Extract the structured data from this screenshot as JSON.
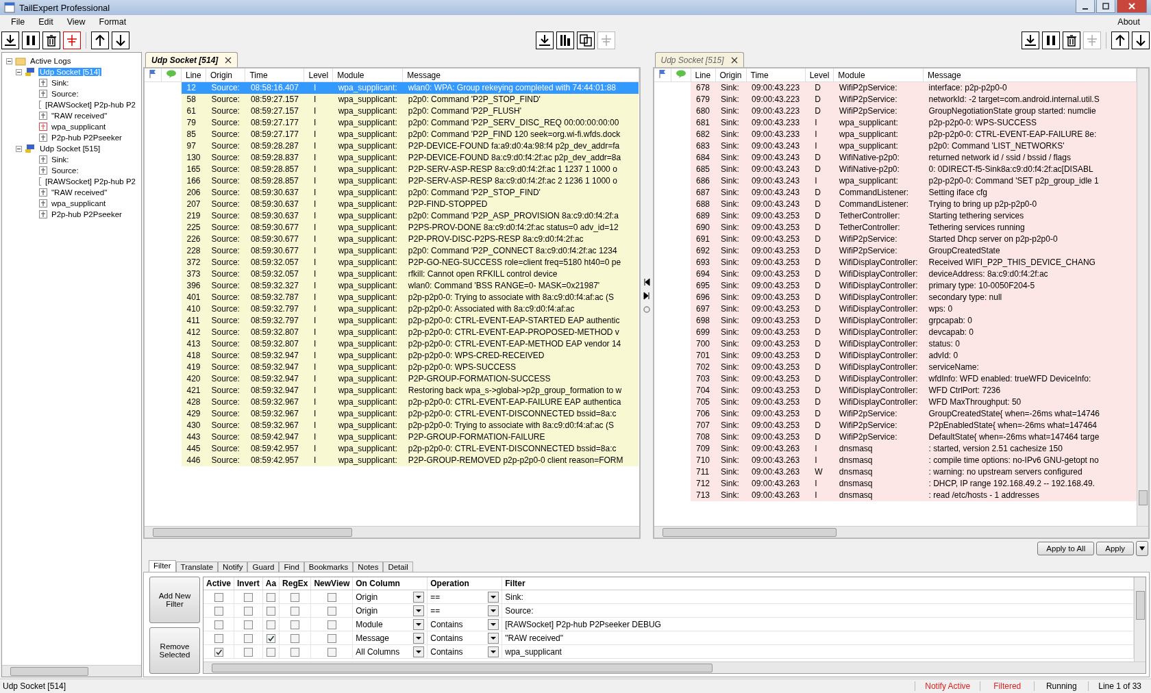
{
  "window": {
    "title": "TailExpert Professional"
  },
  "menu": [
    "File",
    "Edit",
    "View",
    "Format"
  ],
  "menu_right": "About",
  "toolbar_left": [
    {
      "kind": "tail",
      "on": false,
      "disabled": false
    },
    {
      "kind": "pause",
      "on": false,
      "disabled": false
    },
    {
      "kind": "clear",
      "on": false,
      "disabled": false
    },
    {
      "kind": "filter",
      "on": true,
      "disabled": false
    },
    {
      "kind": "up",
      "on": false,
      "disabled": false
    },
    {
      "kind": "down",
      "on": false,
      "disabled": false
    }
  ],
  "toolbar_center": [
    {
      "kind": "tail",
      "disabled": false
    },
    {
      "kind": "columns",
      "disabled": false
    },
    {
      "kind": "copy",
      "disabled": false
    },
    {
      "kind": "filter",
      "disabled": true
    }
  ],
  "toolbar_right": [
    {
      "kind": "tail",
      "disabled": false
    },
    {
      "kind": "pause",
      "disabled": false
    },
    {
      "kind": "clear",
      "disabled": false
    },
    {
      "kind": "filter",
      "disabled": true
    },
    {
      "kind": "up",
      "disabled": false
    },
    {
      "kind": "down",
      "disabled": false
    }
  ],
  "tree": {
    "label": "Active Logs",
    "expanded": true,
    "children": [
      {
        "label": "Udp Socket [514]",
        "selected": true,
        "expanded": true,
        "children": [
          {
            "label": "Sink:",
            "active": false
          },
          {
            "label": "Source:",
            "active": false
          },
          {
            "label": "[RAWSocket] P2p-hub P2",
            "active": false
          },
          {
            "label": "\"RAW received\"",
            "active": false
          },
          {
            "label": "wpa_supplicant",
            "active": true
          },
          {
            "label": "P2p-hub P2Pseeker",
            "active": false
          }
        ]
      },
      {
        "label": "Udp Socket [515]",
        "selected": false,
        "expanded": true,
        "children": [
          {
            "label": "Sink:",
            "active": false
          },
          {
            "label": "Source:",
            "active": false
          },
          {
            "label": "[RAWSocket] P2p-hub P2",
            "active": false
          },
          {
            "label": "\"RAW received\"",
            "active": false
          },
          {
            "label": "wpa_supplicant",
            "active": false
          },
          {
            "label": "P2p-hub P2Pseeker",
            "active": false
          }
        ]
      }
    ]
  },
  "panes": [
    {
      "tab": "Udp Socket [514]",
      "selected": true,
      "color": "#f8f8d2",
      "columns": [
        "Line",
        "Origin",
        "Time",
        "Level",
        "Module",
        "Message"
      ],
      "rows": [
        {
          "line": "12",
          "origin": "Source:",
          "time": "08:58:16.407",
          "level": "I",
          "module": "wpa_supplicant:",
          "message": "wlan0: WPA: Group rekeying completed with 74:44:01:88",
          "selected": true
        },
        {
          "line": "58",
          "origin": "Source:",
          "time": "08:59:27.157",
          "level": "I",
          "module": "wpa_supplicant:",
          "message": "p2p0: Command 'P2P_STOP_FIND'",
          "selected": false
        },
        {
          "line": "61",
          "origin": "Source:",
          "time": "08:59:27.157",
          "level": "I",
          "module": "wpa_supplicant:",
          "message": "p2p0: Command 'P2P_FLUSH'",
          "selected": false
        },
        {
          "line": "79",
          "origin": "Source:",
          "time": "08:59:27.177",
          "level": "I",
          "module": "wpa_supplicant:",
          "message": "p2p0: Command 'P2P_SERV_DISC_REQ 00:00:00:00:00",
          "selected": false
        },
        {
          "line": "85",
          "origin": "Source:",
          "time": "08:59:27.177",
          "level": "I",
          "module": "wpa_supplicant:",
          "message": "p2p0: Command 'P2P_FIND 120 seek=org.wi-fi.wfds.dock",
          "selected": false
        },
        {
          "line": "97",
          "origin": "Source:",
          "time": "08:59:28.287",
          "level": "I",
          "module": "wpa_supplicant:",
          "message": "P2P-DEVICE-FOUND fa:a9:d0:4a:98:f4 p2p_dev_addr=fa",
          "selected": false
        },
        {
          "line": "130",
          "origin": "Source:",
          "time": "08:59:28.837",
          "level": "I",
          "module": "wpa_supplicant:",
          "message": "P2P-DEVICE-FOUND 8a:c9:d0:f4:2f:ac p2p_dev_addr=8a",
          "selected": false
        },
        {
          "line": "165",
          "origin": "Source:",
          "time": "08:59:28.857",
          "level": "I",
          "module": "wpa_supplicant:",
          "message": "P2P-SERV-ASP-RESP 8a:c9:d0:f4:2f:ac 1 1237 1 1000 o",
          "selected": false
        },
        {
          "line": "166",
          "origin": "Source:",
          "time": "08:59:28.857",
          "level": "I",
          "module": "wpa_supplicant:",
          "message": "P2P-SERV-ASP-RESP 8a:c9:d0:f4:2f:ac 2 1236 1 1000 o",
          "selected": false
        },
        {
          "line": "206",
          "origin": "Source:",
          "time": "08:59:30.637",
          "level": "I",
          "module": "wpa_supplicant:",
          "message": "p2p0: Command 'P2P_STOP_FIND'",
          "selected": false
        },
        {
          "line": "207",
          "origin": "Source:",
          "time": "08:59:30.637",
          "level": "I",
          "module": "wpa_supplicant:",
          "message": "P2P-FIND-STOPPED",
          "selected": false
        },
        {
          "line": "219",
          "origin": "Source:",
          "time": "08:59:30.637",
          "level": "I",
          "module": "wpa_supplicant:",
          "message": "p2p0: Command 'P2P_ASP_PROVISION 8a:c9:d0:f4:2f:a",
          "selected": false
        },
        {
          "line": "225",
          "origin": "Source:",
          "time": "08:59:30.677",
          "level": "I",
          "module": "wpa_supplicant:",
          "message": "P2PS-PROV-DONE 8a:c9:d0:f4:2f:ac status=0 adv_id=12",
          "selected": false
        },
        {
          "line": "226",
          "origin": "Source:",
          "time": "08:59:30.677",
          "level": "I",
          "module": "wpa_supplicant:",
          "message": "P2P-PROV-DISC-P2PS-RESP 8a:c9:d0:f4:2f:ac",
          "selected": false
        },
        {
          "line": "228",
          "origin": "Source:",
          "time": "08:59:30.677",
          "level": "I",
          "module": "wpa_supplicant:",
          "message": "p2p0: Command 'P2P_CONNECT 8a:c9:d0:f4:2f:ac 1234",
          "selected": false
        },
        {
          "line": "372",
          "origin": "Source:",
          "time": "08:59:32.057",
          "level": "I",
          "module": "wpa_supplicant:",
          "message": "P2P-GO-NEG-SUCCESS role=client freq=5180 ht40=0 pe",
          "selected": false
        },
        {
          "line": "373",
          "origin": "Source:",
          "time": "08:59:32.057",
          "level": "I",
          "module": "wpa_supplicant:",
          "message": "rfkill: Cannot open RFKILL control device",
          "selected": false
        },
        {
          "line": "396",
          "origin": "Source:",
          "time": "08:59:32.327",
          "level": "I",
          "module": "wpa_supplicant:",
          "message": "wlan0: Command 'BSS RANGE=0- MASK=0x21987'",
          "selected": false
        },
        {
          "line": "401",
          "origin": "Source:",
          "time": "08:59:32.787",
          "level": "I",
          "module": "wpa_supplicant:",
          "message": "p2p-p2p0-0: Trying to associate with 8a:c9:d0:f4:af:ac (S",
          "selected": false
        },
        {
          "line": "410",
          "origin": "Source:",
          "time": "08:59:32.797",
          "level": "I",
          "module": "wpa_supplicant:",
          "message": "p2p-p2p0-0: Associated with 8a:c9:d0:f4:af:ac",
          "selected": false
        },
        {
          "line": "411",
          "origin": "Source:",
          "time": "08:59:32.797",
          "level": "I",
          "module": "wpa_supplicant:",
          "message": "p2p-p2p0-0: CTRL-EVENT-EAP-STARTED EAP authentic",
          "selected": false
        },
        {
          "line": "412",
          "origin": "Source:",
          "time": "08:59:32.807",
          "level": "I",
          "module": "wpa_supplicant:",
          "message": "p2p-p2p0-0: CTRL-EVENT-EAP-PROPOSED-METHOD v",
          "selected": false
        },
        {
          "line": "413",
          "origin": "Source:",
          "time": "08:59:32.807",
          "level": "I",
          "module": "wpa_supplicant:",
          "message": "p2p-p2p0-0: CTRL-EVENT-EAP-METHOD EAP vendor 14",
          "selected": false
        },
        {
          "line": "418",
          "origin": "Source:",
          "time": "08:59:32.947",
          "level": "I",
          "module": "wpa_supplicant:",
          "message": "p2p-p2p0-0: WPS-CRED-RECEIVED",
          "selected": false
        },
        {
          "line": "419",
          "origin": "Source:",
          "time": "08:59:32.947",
          "level": "I",
          "module": "wpa_supplicant:",
          "message": "p2p-p2p0-0: WPS-SUCCESS",
          "selected": false
        },
        {
          "line": "420",
          "origin": "Source:",
          "time": "08:59:32.947",
          "level": "I",
          "module": "wpa_supplicant:",
          "message": "P2P-GROUP-FORMATION-SUCCESS",
          "selected": false
        },
        {
          "line": "421",
          "origin": "Source:",
          "time": "08:59:32.947",
          "level": "I",
          "module": "wpa_supplicant:",
          "message": "Restoring back wpa_s->global->p2p_group_formation to w",
          "selected": false
        },
        {
          "line": "428",
          "origin": "Source:",
          "time": "08:59:32.967",
          "level": "I",
          "module": "wpa_supplicant:",
          "message": "p2p-p2p0-0: CTRL-EVENT-EAP-FAILURE EAP authentica",
          "selected": false
        },
        {
          "line": "429",
          "origin": "Source:",
          "time": "08:59:32.967",
          "level": "I",
          "module": "wpa_supplicant:",
          "message": "p2p-p2p0-0: CTRL-EVENT-DISCONNECTED bssid=8a:c",
          "selected": false
        },
        {
          "line": "430",
          "origin": "Source:",
          "time": "08:59:32.967",
          "level": "I",
          "module": "wpa_supplicant:",
          "message": "p2p-p2p0-0: Trying to associate with 8a:c9:d0:f4:af:ac (S",
          "selected": false
        },
        {
          "line": "443",
          "origin": "Source:",
          "time": "08:59:42.947",
          "level": "I",
          "module": "wpa_supplicant:",
          "message": "P2P-GROUP-FORMATION-FAILURE",
          "selected": false
        },
        {
          "line": "445",
          "origin": "Source:",
          "time": "08:59:42.957",
          "level": "I",
          "module": "wpa_supplicant:",
          "message": "p2p-p2p0-0: CTRL-EVENT-DISCONNECTED bssid=8a:c",
          "selected": false
        },
        {
          "line": "446",
          "origin": "Source:",
          "time": "08:59:42.957",
          "level": "I",
          "module": "wpa_supplicant:",
          "message": "P2P-GROUP-REMOVED p2p-p2p0-0 client reason=FORM",
          "selected": false
        }
      ]
    },
    {
      "tab": "Udp Socket [515]",
      "selected": false,
      "color": "#fde6e6",
      "columns": [
        "Line",
        "Origin",
        "Time",
        "Level",
        "Module",
        "Message"
      ],
      "rows": [
        {
          "line": "678",
          "origin": "Sink:",
          "time": "09:00:43.223",
          "level": "D",
          "module": "WifiP2pService:",
          "message": "interface: p2p-p2p0-0",
          "selected": false
        },
        {
          "line": "679",
          "origin": "Sink:",
          "time": "09:00:43.223",
          "level": "D",
          "module": "WifiP2pService:",
          "message": "networkId: -2 target=com.android.internal.util.S",
          "selected": false
        },
        {
          "line": "680",
          "origin": "Sink:",
          "time": "09:00:43.223",
          "level": "D",
          "module": "WifiP2pService:",
          "message": "GroupNegotiationState group started: numclie",
          "selected": false
        },
        {
          "line": "681",
          "origin": "Sink:",
          "time": "09:00:43.233",
          "level": "I",
          "module": "wpa_supplicant:",
          "message": "p2p-p2p0-0: WPS-SUCCESS",
          "selected": false
        },
        {
          "line": "682",
          "origin": "Sink:",
          "time": "09:00:43.233",
          "level": "I",
          "module": "wpa_supplicant:",
          "message": "p2p-p2p0-0: CTRL-EVENT-EAP-FAILURE 8e:",
          "selected": false
        },
        {
          "line": "683",
          "origin": "Sink:",
          "time": "09:00:43.243",
          "level": "I",
          "module": "wpa_supplicant:",
          "message": "p2p0: Command 'LIST_NETWORKS'",
          "selected": false
        },
        {
          "line": "684",
          "origin": "Sink:",
          "time": "09:00:43.243",
          "level": "D",
          "module": "WifiNative-p2p0:",
          "message": "returned network id / ssid / bssid / flags",
          "selected": false
        },
        {
          "line": "685",
          "origin": "Sink:",
          "time": "09:00:43.243",
          "level": "D",
          "module": "WifiNative-p2p0:",
          "message": "0: 0DIRECT-f5-Sink8a:c9:d0:f4:2f:ac[DISABL",
          "selected": false
        },
        {
          "line": "686",
          "origin": "Sink:",
          "time": "09:00:43.243",
          "level": "I",
          "module": "wpa_supplicant:",
          "message": "p2p-p2p0-0: Command 'SET p2p_group_idle 1",
          "selected": false
        },
        {
          "line": "687",
          "origin": "Sink:",
          "time": "09:00:43.243",
          "level": "D",
          "module": "CommandListener:",
          "message": "Setting iface cfg",
          "selected": false
        },
        {
          "line": "688",
          "origin": "Sink:",
          "time": "09:00:43.243",
          "level": "D",
          "module": "CommandListener:",
          "message": "Trying to bring up p2p-p2p0-0",
          "selected": false
        },
        {
          "line": "689",
          "origin": "Sink:",
          "time": "09:00:43.253",
          "level": "D",
          "module": "TetherController:",
          "message": "Starting tethering services",
          "selected": false
        },
        {
          "line": "690",
          "origin": "Sink:",
          "time": "09:00:43.253",
          "level": "D",
          "module": "TetherController:",
          "message": "Tethering services running",
          "selected": false
        },
        {
          "line": "691",
          "origin": "Sink:",
          "time": "09:00:43.253",
          "level": "D",
          "module": "WifiP2pService:",
          "message": "Started Dhcp server on p2p-p2p0-0",
          "selected": false
        },
        {
          "line": "692",
          "origin": "Sink:",
          "time": "09:00:43.253",
          "level": "D",
          "module": "WifiP2pService:",
          "message": "GroupCreatedState",
          "selected": false
        },
        {
          "line": "693",
          "origin": "Sink:",
          "time": "09:00:43.253",
          "level": "D",
          "module": "WifiDisplayController:",
          "message": "Received WIFI_P2P_THIS_DEVICE_CHANG",
          "selected": false
        },
        {
          "line": "694",
          "origin": "Sink:",
          "time": "09:00:43.253",
          "level": "D",
          "module": "WifiDisplayController:",
          "message": "deviceAddress: 8a:c9:d0:f4:2f:ac",
          "selected": false
        },
        {
          "line": "695",
          "origin": "Sink:",
          "time": "09:00:43.253",
          "level": "D",
          "module": "WifiDisplayController:",
          "message": "primary type: 10-0050F204-5",
          "selected": false
        },
        {
          "line": "696",
          "origin": "Sink:",
          "time": "09:00:43.253",
          "level": "D",
          "module": "WifiDisplayController:",
          "message": "secondary type: null",
          "selected": false
        },
        {
          "line": "697",
          "origin": "Sink:",
          "time": "09:00:43.253",
          "level": "D",
          "module": "WifiDisplayController:",
          "message": "wps: 0",
          "selected": false
        },
        {
          "line": "698",
          "origin": "Sink:",
          "time": "09:00:43.253",
          "level": "D",
          "module": "WifiDisplayController:",
          "message": "grpcapab: 0",
          "selected": false
        },
        {
          "line": "699",
          "origin": "Sink:",
          "time": "09:00:43.253",
          "level": "D",
          "module": "WifiDisplayController:",
          "message": "devcapab: 0",
          "selected": false
        },
        {
          "line": "700",
          "origin": "Sink:",
          "time": "09:00:43.253",
          "level": "D",
          "module": "WifiDisplayController:",
          "message": "status: 0",
          "selected": false
        },
        {
          "line": "701",
          "origin": "Sink:",
          "time": "09:00:43.253",
          "level": "D",
          "module": "WifiDisplayController:",
          "message": "advId: 0",
          "selected": false
        },
        {
          "line": "702",
          "origin": "Sink:",
          "time": "09:00:43.253",
          "level": "D",
          "module": "WifiDisplayController:",
          "message": "serviceName:",
          "selected": false
        },
        {
          "line": "703",
          "origin": "Sink:",
          "time": "09:00:43.253",
          "level": "D",
          "module": "WifiDisplayController:",
          "message": "wfdInfo: WFD enabled: trueWFD DeviceInfo:",
          "selected": false
        },
        {
          "line": "704",
          "origin": "Sink:",
          "time": "09:00:43.253",
          "level": "D",
          "module": "WifiDisplayController:",
          "message": "WFD CtrlPort: 7236",
          "selected": false
        },
        {
          "line": "705",
          "origin": "Sink:",
          "time": "09:00:43.253",
          "level": "D",
          "module": "WifiDisplayController:",
          "message": "WFD MaxThroughput: 50",
          "selected": false
        },
        {
          "line": "706",
          "origin": "Sink:",
          "time": "09:00:43.253",
          "level": "D",
          "module": "WifiP2pService:",
          "message": "GroupCreatedState{ when=-26ms what=14746",
          "selected": false
        },
        {
          "line": "707",
          "origin": "Sink:",
          "time": "09:00:43.253",
          "level": "D",
          "module": "WifiP2pService:",
          "message": "P2pEnabledState{ when=-26ms what=147464",
          "selected": false
        },
        {
          "line": "708",
          "origin": "Sink:",
          "time": "09:00:43.253",
          "level": "D",
          "module": "WifiP2pService:",
          "message": "DefaultState{ when=-26ms what=147464 targe",
          "selected": false
        },
        {
          "line": "709",
          "origin": "Sink:",
          "time": "09:00:43.263",
          "level": "I",
          "module": "dnsmasq",
          "message": ": started, version 2.51 cachesize 150",
          "selected": false
        },
        {
          "line": "710",
          "origin": "Sink:",
          "time": "09:00:43.263",
          "level": "I",
          "module": "dnsmasq",
          "message": ": compile time options: no-IPv6 GNU-getopt no",
          "selected": false
        },
        {
          "line": "711",
          "origin": "Sink:",
          "time": "09:00:43.263",
          "level": "W",
          "module": "dnsmasq",
          "message": ": warning: no upstream servers configured",
          "selected": false
        },
        {
          "line": "712",
          "origin": "Sink:",
          "time": "09:00:43.263",
          "level": "I",
          "module": "dnsmasq",
          "message": ": DHCP, IP range 192.168.49.2 -- 192.168.49.",
          "selected": false
        },
        {
          "line": "713",
          "origin": "Sink:",
          "time": "09:00:43.263",
          "level": "I",
          "module": "dnsmasq",
          "message": ": read /etc/hosts - 1 addresses",
          "selected": false
        }
      ]
    }
  ],
  "apply_buttons": [
    "Apply to All",
    "Apply"
  ],
  "bottom_tabs": [
    {
      "label": "Filter",
      "selected": true
    },
    {
      "label": "Translate",
      "selected": false
    },
    {
      "label": "Notify",
      "selected": false
    },
    {
      "label": "Guard",
      "selected": false
    },
    {
      "label": "Find",
      "selected": false
    },
    {
      "label": "Bookmarks",
      "selected": false
    },
    {
      "label": "Notes",
      "selected": false
    },
    {
      "label": "Detail",
      "selected": false
    }
  ],
  "filter_buttons": [
    "Add New Filter",
    "Remove Selected"
  ],
  "filter_columns": [
    "Active",
    "Invert",
    "Aa",
    "RegEx",
    "NewView",
    "On Column",
    "Operation",
    "Filter"
  ],
  "filters": [
    {
      "active": false,
      "invert": false,
      "aa": false,
      "regex": false,
      "newview": false,
      "column": "Origin",
      "operation": "==",
      "filter": "Sink:"
    },
    {
      "active": false,
      "invert": false,
      "aa": false,
      "regex": false,
      "newview": false,
      "column": "Origin",
      "operation": "==",
      "filter": "Source:"
    },
    {
      "active": false,
      "invert": false,
      "aa": false,
      "regex": false,
      "newview": false,
      "column": "Module",
      "operation": "Contains",
      "filter": "[RAWSocket] P2p-hub P2Pseeker DEBUG"
    },
    {
      "active": false,
      "invert": false,
      "aa": true,
      "regex": false,
      "newview": false,
      "column": "Message",
      "operation": "Contains",
      "filter": "\"RAW received\""
    },
    {
      "active": true,
      "invert": false,
      "aa": false,
      "regex": false,
      "newview": false,
      "column": "All Columns",
      "operation": "Contains",
      "filter": "wpa_supplicant"
    }
  ],
  "status_bar": {
    "left": "Udp Socket [514]",
    "segments": [
      {
        "text": "Notify Active",
        "color": "#e02020"
      },
      {
        "text": "Filtered",
        "color": "#e02020"
      },
      {
        "text": "Running",
        "color": "#000000"
      },
      {
        "text": "Line 1 of 33",
        "color": "#000000"
      }
    ]
  }
}
